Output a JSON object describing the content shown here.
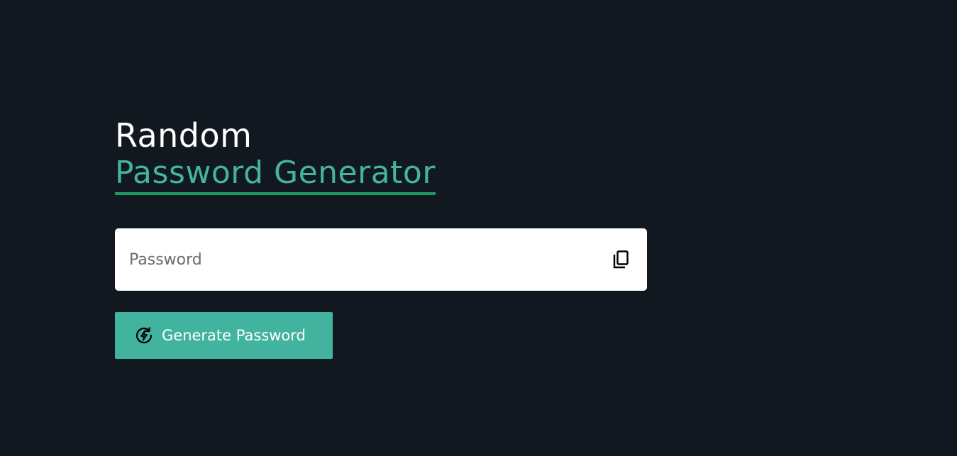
{
  "header": {
    "title_line1": "Random",
    "title_line2": "Password Generator"
  },
  "password_field": {
    "placeholder": "Password",
    "value": "",
    "copy_icon": "copy-icon"
  },
  "generate_button": {
    "label": "Generate Password",
    "icon": "lightning-refresh-icon"
  },
  "colors": {
    "background": "#121820",
    "accent": "#44b39f",
    "underline": "#1e9960",
    "button": "#42b39f",
    "title": "#ffffff"
  }
}
